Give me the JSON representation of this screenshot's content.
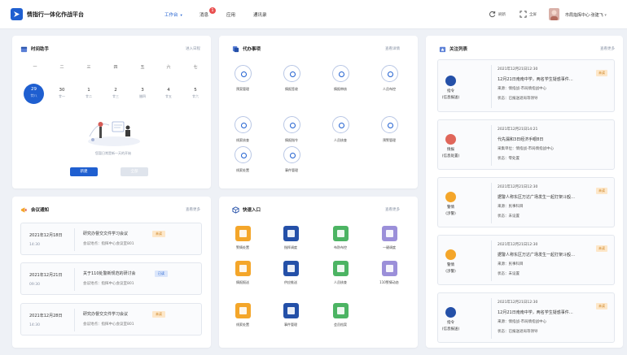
{
  "header": {
    "title": "情指行一体化作战平台",
    "nav": [
      "工作台",
      "消息",
      "应用",
      "通讯录"
    ],
    "message_badge": "1",
    "refresh_label": "刷新",
    "fullscreen_label": "全屏",
    "user": "市局指挥中心-张建飞",
    "accent": "#1f5fd0"
  },
  "calendar": {
    "title": "时间助手",
    "more": "进入日程",
    "weekdays": [
      "一",
      "二",
      "三",
      "四",
      "五",
      "六",
      "七"
    ],
    "days": [
      {
        "num": "29",
        "lunar": "廿八"
      },
      {
        "num": "30",
        "lunar": "廿一"
      },
      {
        "num": "1",
        "lunar": "廿二"
      },
      {
        "num": "2",
        "lunar": "廿三"
      },
      {
        "num": "3",
        "lunar": "腊四"
      },
      {
        "num": "4",
        "lunar": "廿五"
      },
      {
        "num": "5",
        "lunar": "廿六"
      }
    ],
    "selected_index": 0,
    "hint": "您暂日常是新一天的开始",
    "new_button": "新建",
    "all_button": "全部"
  },
  "meetings": {
    "title": "会议通知",
    "more": "查看更多",
    "items": [
      {
        "date": "2021年12月18日",
        "time": "14:30",
        "title": "研究办督交文件学习会议",
        "loc": "会议地点：指挥中心会议室801",
        "tag": "未读"
      },
      {
        "date": "2021年12月21日",
        "time": "09:30",
        "title": "关于110处警新规范的研讨会",
        "loc": "会议地点：指挥中心会议室801",
        "tag": "已读"
      },
      {
        "date": "2021年12月28日",
        "time": "14:30",
        "title": "研究办督交文件学习会议",
        "loc": "会议地点：指挥中心会议室801",
        "tag": "未读"
      }
    ]
  },
  "todo": {
    "title": "代办事项",
    "more": "查看详情",
    "items": [
      "预案管理",
      "情报签收",
      "情报审核",
      "人员布控",
      "线索核查",
      "情报指令",
      "人员核查",
      "预警管理",
      "线索处置",
      "事件管理"
    ]
  },
  "quick": {
    "title": "快速入口",
    "more": "查看更多",
    "items": [
      {
        "label": "警情处置",
        "color": "#f4a62a"
      },
      {
        "label": "指挥调度",
        "color": "#2450a8"
      },
      {
        "label": "布防布控",
        "color": "#4cb463"
      },
      {
        "label": "一键调度",
        "color": "#9b8fd9"
      },
      {
        "label": "情报报送",
        "color": "#f4a62a"
      },
      {
        "label": "供应推送",
        "color": "#2450a8"
      },
      {
        "label": "人员核查",
        "color": "#4cb463"
      },
      {
        "label": "110警情动态",
        "color": "#9b8fd9"
      },
      {
        "label": "线索处置",
        "color": "#f4a62a"
      },
      {
        "label": "事件管理",
        "color": "#2450a8"
      },
      {
        "label": "会员档案",
        "color": "#4cb463"
      }
    ]
  },
  "focus": {
    "title": "关注列表",
    "more": "查看更多",
    "items": [
      {
        "type": "指令\n(信息报送)",
        "icon_color": "#2450a8",
        "lines": [
          "2021年12月21日12:30",
          "12月21日南南中学，两名学生疑惑事件…",
          "来源：情指战-市局情指战中心",
          "状态：已报送退局等领导"
        ],
        "tag": "未读"
      },
      {
        "type": "情报\n(信息处置)",
        "icon_color": "#e0665a",
        "lines": [
          "2021年12月21日14:21",
          "代先漏和3日经济手眼8日",
          "采集单位：情指战-市局情指战中心",
          "状态：零处置"
        ],
        "tag": ""
      },
      {
        "type": "警情\n(涉警)",
        "icon_color": "#f4a62a",
        "lines": [
          "2021年12月21日12:30",
          "据警人称东区万达广场发生一起打架斗殴…",
          "来源：民事科目",
          "状态：未设置"
        ],
        "tag": "未读"
      },
      {
        "type": "警情\n(涉警)",
        "icon_color": "#f4a62a",
        "lines": [
          "2021年12月21日12:30",
          "据警人称东区万达广场发生一起打架斗殴…",
          "来源：民事科目",
          "状态：未设置"
        ],
        "tag": "未读"
      },
      {
        "type": "指令\n(信息报送)",
        "icon_color": "#2450a8",
        "lines": [
          "2021年12月21日12:30",
          "12月21日南南中学，两名学生疑惑事件…",
          "来源：情指战-市局情指战中心",
          "状态：已报送退局等领导"
        ],
        "tag": "未读"
      }
    ]
  }
}
